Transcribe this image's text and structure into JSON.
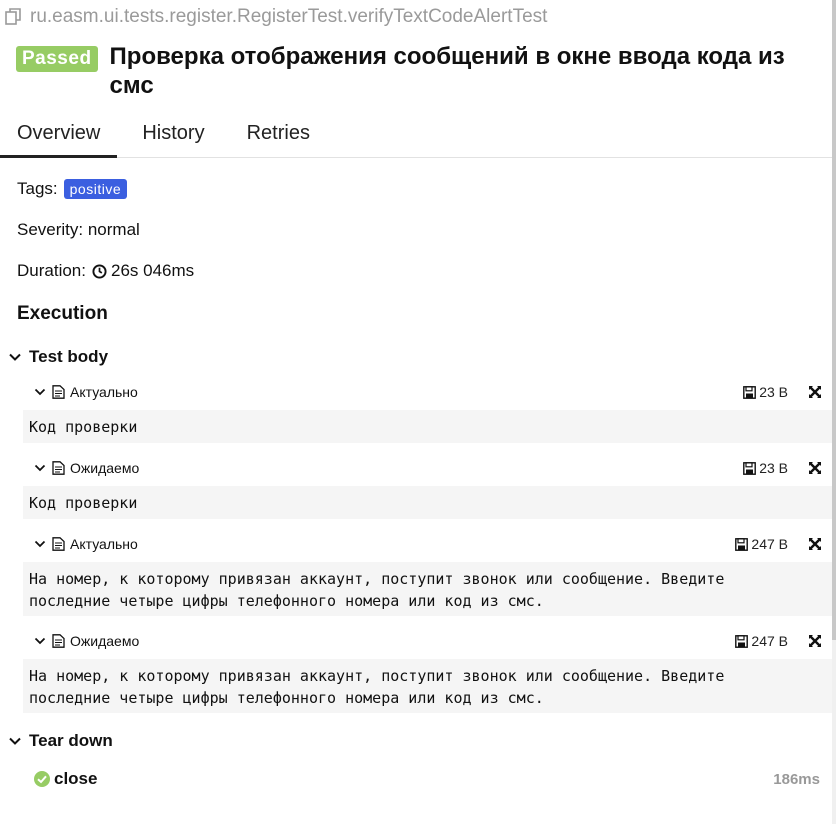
{
  "test": {
    "full_name": "ru.easm.ui.tests.register.RegisterTest.verifyTextCodeAlertTest",
    "status": "Passed",
    "title": "Проверка отображения сообщений в окне ввода кода из смс"
  },
  "tabs": [
    {
      "label": "Overview",
      "active": true
    },
    {
      "label": "History",
      "active": false
    },
    {
      "label": "Retries",
      "active": false
    }
  ],
  "overview": {
    "tags_label": "Tags:",
    "tag": "positive",
    "severity_text": "Severity: normal",
    "duration_label": "Duration:",
    "duration_value": "26s 046ms"
  },
  "execution": {
    "title": "Execution",
    "test_body": {
      "label": "Test body",
      "attachments": [
        {
          "name": "Актуально",
          "size": "23 B",
          "content": "Код проверки"
        },
        {
          "name": "Ожидаемо",
          "size": "23 B",
          "content": "Код проверки"
        },
        {
          "name": "Актуально",
          "size": "247 B",
          "content": "На номер, к которому привязан аккаунт, поступит звонок или сообщение. Введите\nпоследние четыре цифры телефонного номера или код из смс."
        },
        {
          "name": "Ожидаемо",
          "size": "247 B",
          "content": "На номер, к которому привязан аккаунт, поступит звонок или сообщение. Введите\nпоследние четыре цифры телефонного номера или код из смс."
        }
      ]
    },
    "tear_down": {
      "label": "Tear down",
      "steps": [
        {
          "name": "close",
          "duration": "186ms",
          "status": "passed"
        }
      ]
    }
  },
  "colors": {
    "passed": "#97cc64",
    "tag": "#3b5fe0",
    "check": "#97cc64"
  }
}
